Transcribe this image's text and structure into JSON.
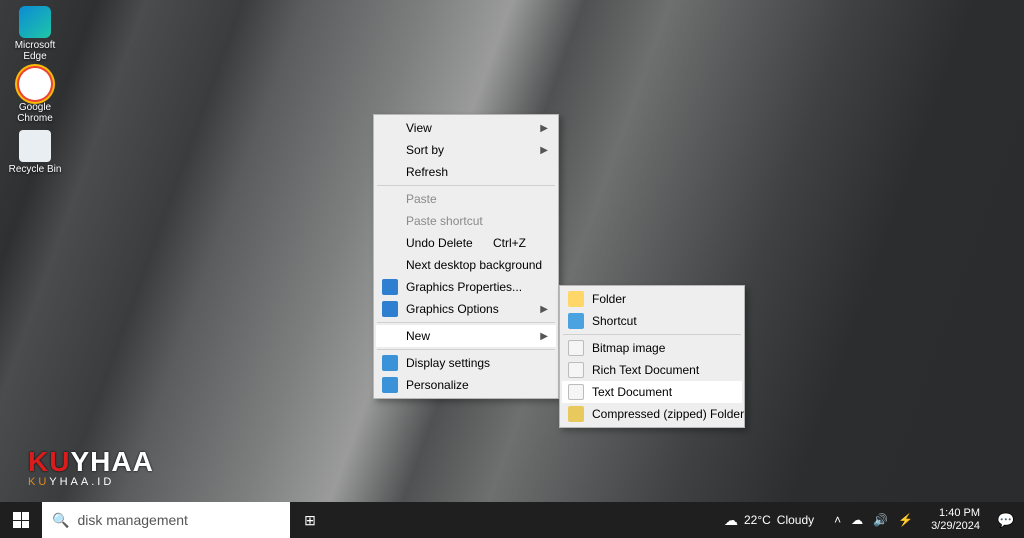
{
  "desktop_icons": [
    {
      "name": "microsoft-edge",
      "label": "Microsoft\nEdge"
    },
    {
      "name": "google-chrome",
      "label": "Google\nChrome"
    },
    {
      "name": "recycle-bin",
      "label": "Recycle Bin"
    }
  ],
  "watermark": {
    "main_red": "KU",
    "main_white": "YHAA",
    "sub_orange": "KU",
    "sub_white": "YHAA.ID"
  },
  "context_menu": {
    "view": "View",
    "sort_by": "Sort by",
    "refresh": "Refresh",
    "paste": "Paste",
    "paste_shortcut": "Paste shortcut",
    "undo_delete": "Undo Delete",
    "undo_delete_key": "Ctrl+Z",
    "next_bg": "Next desktop background",
    "gfx_props": "Graphics Properties...",
    "gfx_opts": "Graphics Options",
    "new": "New",
    "display": "Display settings",
    "personalize": "Personalize"
  },
  "new_submenu": {
    "folder": "Folder",
    "shortcut": "Shortcut",
    "bitmap": "Bitmap image",
    "rtf": "Rich Text Document",
    "txt": "Text Document",
    "zip": "Compressed (zipped) Folder"
  },
  "taskbar": {
    "search_value": "disk management",
    "weather_temp": "22°C",
    "weather_text": "Cloudy",
    "time": "1:40 PM",
    "date": "3/29/2024"
  }
}
